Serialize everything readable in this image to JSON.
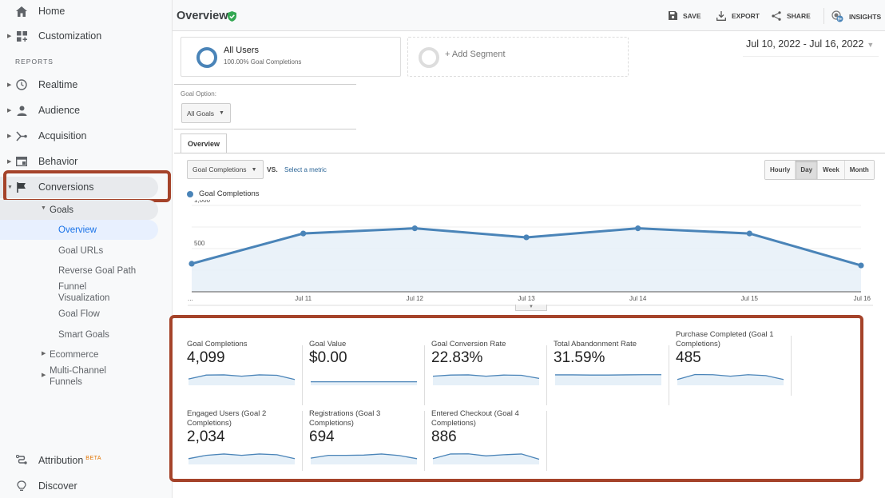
{
  "sidebar": {
    "home": "Home",
    "customization": "Customization",
    "reports_label": "REPORTS",
    "realtime": "Realtime",
    "audience": "Audience",
    "acquisition": "Acquisition",
    "behavior": "Behavior",
    "conversions": "Conversions",
    "goals": "Goals",
    "goals_children": [
      "Overview",
      "Goal URLs",
      "Reverse Goal Path",
      "Funnel Visualization",
      "Goal Flow",
      "Smart Goals"
    ],
    "funnel_line1": "Funnel",
    "funnel_line2": "Visualization",
    "ecommerce": "Ecommerce",
    "multichannel_line1": "Multi-Channel",
    "multichannel_line2": "Funnels",
    "attribution": "Attribution",
    "attribution_badge": "BETA",
    "discover": "Discover"
  },
  "header": {
    "title": "Overview",
    "save": "SAVE",
    "export": "EXPORT",
    "share": "SHARE",
    "insights": "INSIGHTS"
  },
  "segments": {
    "all_users_title": "All Users",
    "all_users_sub": "100.00% Goal Completions",
    "add_segment": "+ Add Segment"
  },
  "date_range": "Jul 10, 2022 - Jul 16, 2022",
  "goal_option": {
    "label": "Goal Option:",
    "selected": "All Goals"
  },
  "tabs": {
    "overview": "Overview"
  },
  "metric_selector": {
    "primary": "Goal Completions",
    "vs": "VS.",
    "secondary": "Select a metric"
  },
  "granularity": {
    "options": [
      "Hourly",
      "Day",
      "Week",
      "Month"
    ],
    "selected": "Day"
  },
  "colors": {
    "series": "#4a84b8",
    "fill": "#e6f0f8",
    "highlight": "#a5432a",
    "verified": "#34a853"
  },
  "chart_data": {
    "type": "area",
    "title": "",
    "legend": [
      "Goal Completions"
    ],
    "legend_position": "top-left",
    "x": [
      "...",
      "Jul 11",
      "Jul 12",
      "Jul 13",
      "Jul 14",
      "Jul 15",
      "Jul 16"
    ],
    "series": [
      {
        "name": "Goal Completions",
        "values": [
          325,
          675,
          735,
          630,
          735,
          675,
          305
        ]
      }
    ],
    "y_ticks": [
      "1,000",
      "500"
    ],
    "ylim": [
      0,
      1000
    ],
    "grid": true,
    "xlabel": "",
    "ylabel": ""
  },
  "scorecards": [
    {
      "name": "Goal Completions",
      "value": "4,099",
      "spark": [
        0.35,
        0.7,
        0.72,
        0.6,
        0.72,
        0.68,
        0.3
      ]
    },
    {
      "name": "Goal Value",
      "value": "$0.00",
      "spark": [
        0.1,
        0.1,
        0.1,
        0.1,
        0.1,
        0.1,
        0.1
      ]
    },
    {
      "name": "Goal Conversion Rate",
      "value": "22.83%",
      "spark": [
        0.6,
        0.7,
        0.72,
        0.6,
        0.7,
        0.68,
        0.4
      ]
    },
    {
      "name": "Total Abandonment Rate",
      "value": "31.59%",
      "spark": [
        0.72,
        0.72,
        0.7,
        0.7,
        0.72,
        0.73,
        0.73
      ]
    },
    {
      "name": "Purchase Completed (Goal 1 Completions)",
      "value": "485",
      "spark": [
        0.3,
        0.75,
        0.73,
        0.6,
        0.73,
        0.65,
        0.3
      ]
    },
    {
      "name": "Engaged Users (Goal 2 Completions)",
      "value": "2,034",
      "spark": [
        0.3,
        0.6,
        0.72,
        0.6,
        0.72,
        0.65,
        0.3
      ]
    },
    {
      "name": "Registrations (Goal 3 Completions)",
      "value": "694",
      "spark": [
        0.35,
        0.6,
        0.6,
        0.62,
        0.72,
        0.58,
        0.3
      ]
    },
    {
      "name": "Entered Checkout (Goal 4 Completions)",
      "value": "886",
      "spark": [
        0.3,
        0.72,
        0.73,
        0.55,
        0.65,
        0.72,
        0.25
      ]
    }
  ]
}
